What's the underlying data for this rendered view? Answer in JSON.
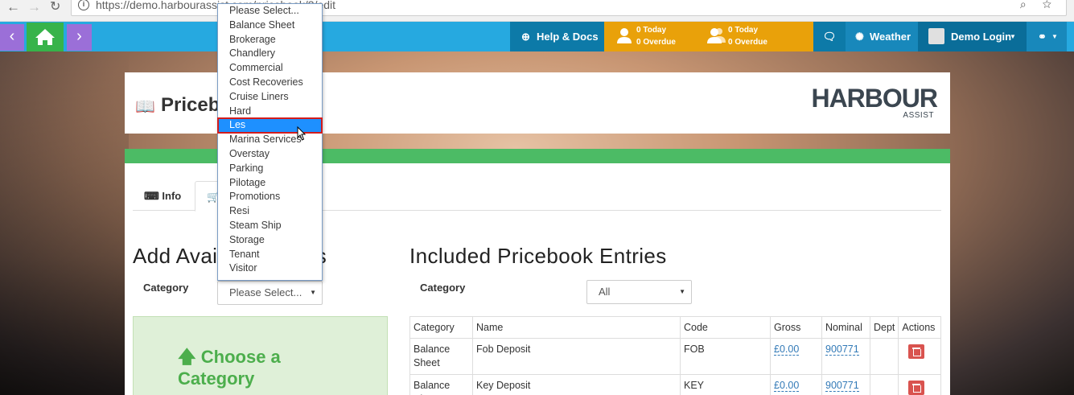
{
  "browser": {
    "url": "https://demo.harbourassist.com/pricebook/3/edit",
    "back_icon": "arrow-left-icon",
    "forward_icon": "arrow-right-icon",
    "reload_icon": "reload-icon"
  },
  "nav": {
    "help_label": "Help & Docs",
    "tasks_today": "0 Today",
    "tasks_overdue": "0 Overdue",
    "group_today": "0 Today",
    "group_overdue": "0 Overdue",
    "weather_label": "Weather",
    "user_label": "Demo Login"
  },
  "header": {
    "title": "Pricebook",
    "logo_main": "HARBOUR",
    "logo_sub": "ASSIST"
  },
  "tabs": [
    {
      "label": "Info"
    },
    {
      "label": ""
    }
  ],
  "left": {
    "heading": "Add Available Tariffs",
    "category_label": "Category",
    "category_select": "Please Select...",
    "choose_text": "Choose a Category"
  },
  "right": {
    "heading": "Included Pricebook Entries",
    "category_label": "Category",
    "category_select": "All"
  },
  "table": {
    "headers": [
      "Category",
      "Name",
      "Code",
      "Gross",
      "Nominal",
      "Dept",
      "Actions"
    ],
    "rows": [
      {
        "category": "Balance Sheet",
        "name": "Fob Deposit",
        "code": "FOB",
        "gross": "£0.00",
        "nominal": "900771",
        "dept": ""
      },
      {
        "category": "Balance Sheet",
        "name": "Key Deposit",
        "code": "KEY",
        "gross": "£0.00",
        "nominal": "900771",
        "dept": ""
      }
    ]
  },
  "dropdown": {
    "options": [
      "Please Select...",
      "Balance Sheet",
      "Brokerage",
      "Chandlery",
      "Commercial",
      "Cost Recoveries",
      "Cruise Liners",
      "Hard",
      "Les",
      "Marina Services",
      "Overstay",
      "Parking",
      "Pilotage",
      "Promotions",
      "Resi",
      "Steam Ship",
      "Storage",
      "Tenant",
      "Visitor"
    ],
    "highlighted": "Les"
  },
  "colors": {
    "navbar": "#26a9e0",
    "orange": "#e9a10a",
    "green": "#4cbb65",
    "purple": "#9b6fd8",
    "highlight": "#1e90ff"
  }
}
